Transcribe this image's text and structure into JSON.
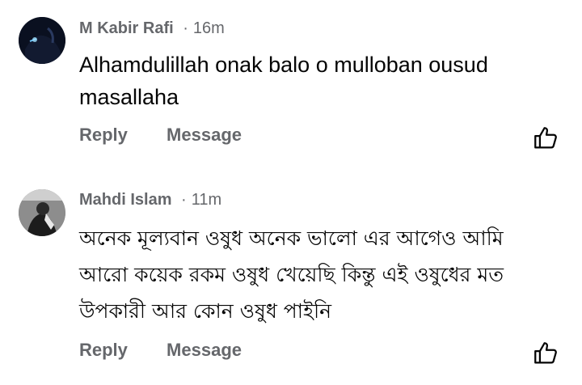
{
  "comments": [
    {
      "author": "M Kabir Rafi",
      "separator": "·",
      "time": "16m",
      "text": "Alhamdulillah onak balo o mulloban ousud masallaha",
      "reply_label": "Reply",
      "message_label": "Message",
      "like_icon": "thumbs-up-icon",
      "avatar_icon": "avatar"
    },
    {
      "author": "Mahdi Islam",
      "separator": "·",
      "time": "11m",
      "text": "অনেক মূল্যবান ওষুধ অনেক ভালো এর আগেও আমি আরো কয়েক রকম ওষুধ খেয়েছি কিন্তু এই ওষুধের মত উপকারী আর কোন ওষুধ পাইনি",
      "reply_label": "Reply",
      "message_label": "Message",
      "like_icon": "thumbs-up-icon",
      "avatar_icon": "avatar"
    }
  ],
  "colors": {
    "meta": "#65676b",
    "text": "#050505",
    "background": "#ffffff"
  }
}
